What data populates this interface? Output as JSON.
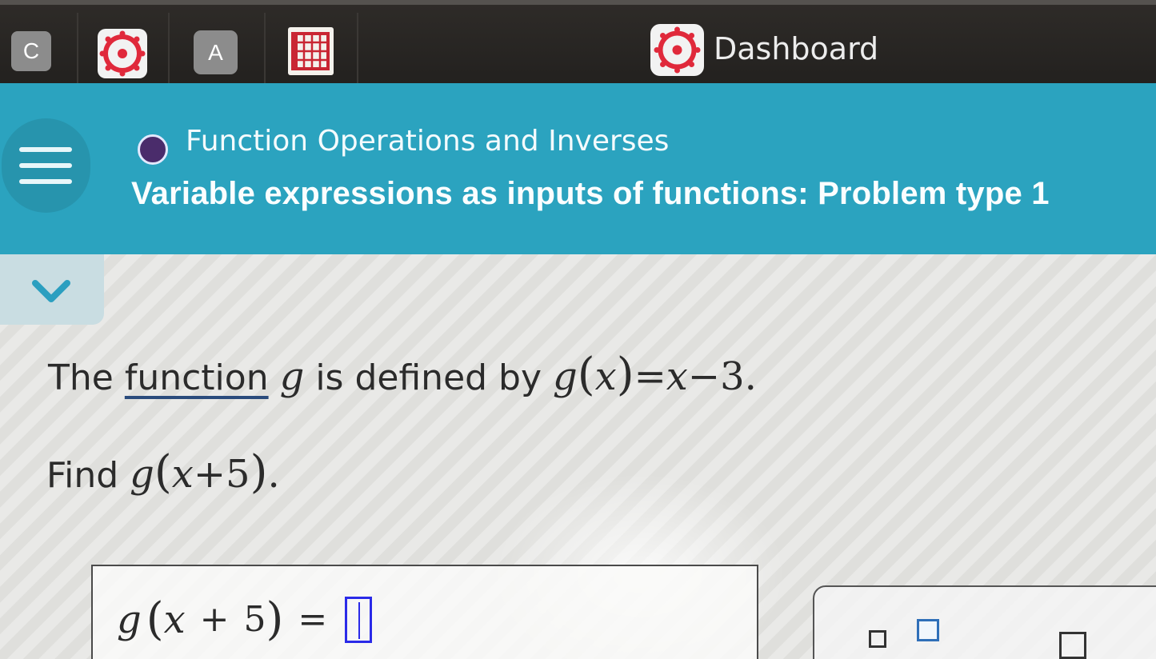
{
  "tabs": {
    "items": [
      {
        "label": "C",
        "icon": "c-letter-icon"
      },
      {
        "label": "",
        "icon": "canvas-logo-icon"
      },
      {
        "label": "A",
        "icon": "a-letter-icon"
      },
      {
        "label": "",
        "icon": "book-grid-icon"
      }
    ],
    "dashboard": {
      "label": "Dashboard",
      "icon": "canvas-logo-icon"
    }
  },
  "header": {
    "topic": "Function Operations and Inverses",
    "problem_title": "Variable expressions as inputs of functions: Problem type 1",
    "menu_icon": "hamburger-menu-icon"
  },
  "colors": {
    "header_bg": "#2ba3bf",
    "topic_dot": "#4a2c6b",
    "input_border": "#2a2ae8"
  },
  "problem": {
    "statement_prefix": "The",
    "link_word": "function",
    "func_name": "g",
    "statement_middle": "is defined by",
    "definition_lhs_func": "g",
    "definition_arg": "x",
    "definition_eq": "=",
    "definition_rhs": "x",
    "definition_minus": "−",
    "definition_const": "3",
    "definition_period": ".",
    "find_label": "Find",
    "find_func": "g",
    "find_arg_var": "x",
    "find_plus": "+",
    "find_const": "5",
    "find_period": "."
  },
  "answer": {
    "func": "g",
    "var": "x",
    "plus": "+",
    "const": "5",
    "eq": "=",
    "value": ""
  }
}
